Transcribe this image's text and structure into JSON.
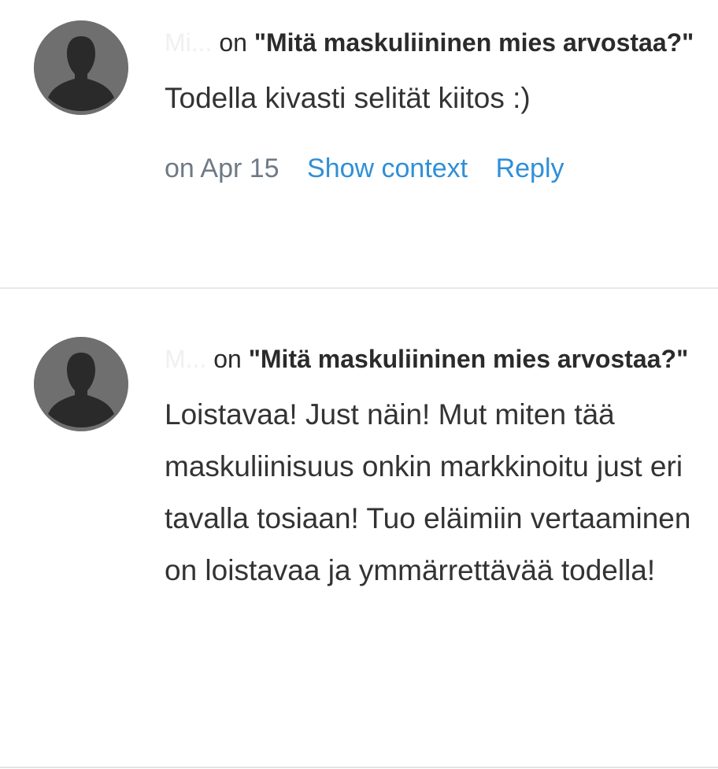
{
  "comments": [
    {
      "author": "Mi...",
      "on_word": "on",
      "post_title": "\"Mitä maskuliininen mies arvostaa?\"",
      "body": "Todella kivasti selität kiitos :)",
      "date": "on Apr 15",
      "show_context_label": "Show context",
      "reply_label": "Reply"
    },
    {
      "author": "M...",
      "on_word": "on",
      "post_title": "\"Mitä maskuliininen mies arvostaa?\"",
      "body": "Loistavaa! Just näin! Mut miten tää maskuliinisuus onkin markkinoitu just eri tavalla tosiaan! Tuo eläimiin vertaaminen on loistavaa ja ymmärrettävää todella!"
    }
  ],
  "icons": {
    "avatar": "user-silhouette-icon"
  },
  "colors": {
    "link": "#2f8fd8",
    "meta": "#6e7a86",
    "avatar_bg": "#6f6f6f",
    "silhouette": "#2a2a2a",
    "divider": "#e4e9ee"
  }
}
